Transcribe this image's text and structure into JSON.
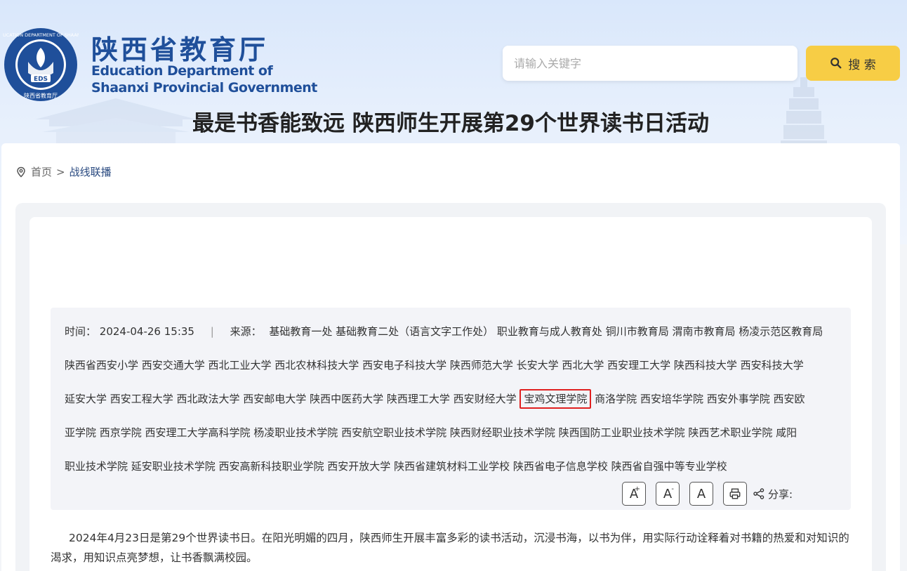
{
  "header": {
    "logo_title_cn": "陕西省教育厅",
    "logo_title_en_line1": "Education Department of",
    "logo_title_en_line2": "Shaanxi Provincial Government",
    "seal_text_top": "EDUCATION DEPARTMENT OF SHAANXI",
    "seal_text_bottom": "陕西省教育厅",
    "seal_center": "EDS",
    "brand_color": "#1f4f9a"
  },
  "search": {
    "placeholder": "请输入关键字",
    "button_label": "搜 索",
    "button_color": "#f7cd45"
  },
  "breadcrumb": {
    "home": "首页",
    "separator": ">",
    "current": "战线联播"
  },
  "article": {
    "title": "最是书香能致远 陕西师生开展第29个世界读书日活动",
    "time_label": "时间：",
    "time_value": "2024-04-26 15:35",
    "divider": "|",
    "source_label": "来源：",
    "source_line1": "基础教育一处 基础教育二处（语言文字工作处） 职业教育与成人教育处 铜川市教育局 渭南市教育局 杨凌示范区教育局",
    "source_line2": "陕西省西安小学 西安交通大学 西北工业大学 西北农林科技大学 西安电子科技大学 陕西师范大学 长安大学 西北大学 西安理工大学 陕西科技大学 西安科技大学",
    "source_line3_before": "延安大学 西安工程大学 西北政法大学 西安邮电大学 陕西中医药大学 陕西理工大学 西安财经大学 ",
    "source_line3_highlight": "宝鸡文理学院",
    "source_line3_after": " 商洛学院 西安培华学院 西安外事学院 西安欧",
    "source_line4": "亚学院 西京学院 西安理工大学高科学院 杨凌职业技术学院 西安航空职业技术学院 陕西财经职业技术学院 陕西国防工业职业技术学院 陕西艺术职业学院 咸阳",
    "source_line5": "职业技术学院 延安职业技术学院 西安高新科技职业学院 西安开放大学 陕西省建筑材料工业学校 陕西省电子信息学校 陕西省自强中等专业学校",
    "highlight_color": "#e02020",
    "tools": {
      "font_increase": "A",
      "font_increase_sup": "+",
      "font_decrease": "A",
      "font_decrease_sup": "-",
      "font_reset": "A",
      "share_label": "分享:"
    },
    "body": "2024年4月23日是第29个世界读书日。在阳光明媚的四月，陕西师生开展丰富多彩的读书活动，沉浸书海，以书为伴，用实际行动诠释着对书籍的热爱和对知识的渴求，用知识点亮梦想，让书香飘满校园。"
  }
}
